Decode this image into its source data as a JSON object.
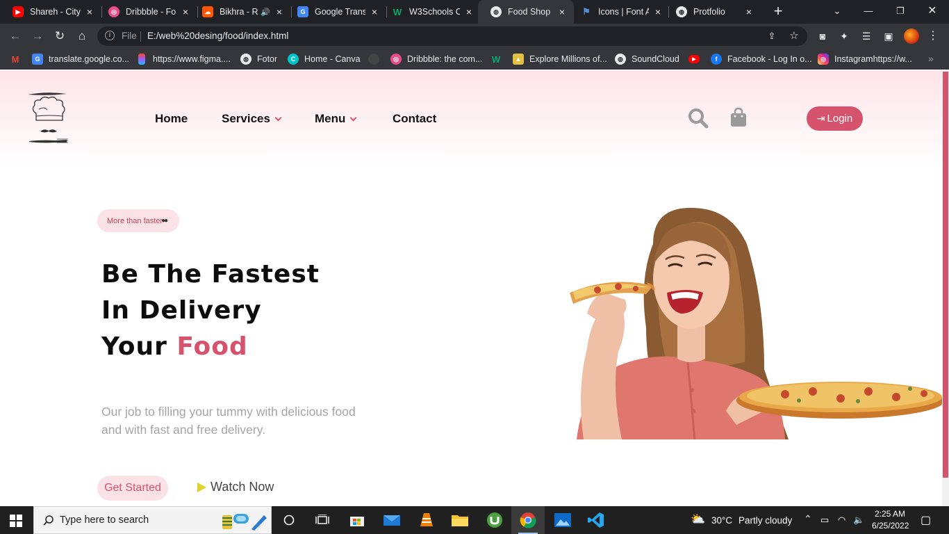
{
  "browser": {
    "tabs": [
      {
        "title": "Shareh - City",
        "icon": "youtube-icon",
        "color": "#ff0000"
      },
      {
        "title": "Dribbble - Fo",
        "icon": "dribbble-icon",
        "color": "#ea4c89"
      },
      {
        "title": "Bikhra - R",
        "icon": "soundcloud-icon",
        "color": "#ff5500",
        "audio": true
      },
      {
        "title": "Google Transl",
        "icon": "google-translate-icon",
        "color": "#4285f4"
      },
      {
        "title": "W3Schools O",
        "icon": "w3schools-icon",
        "color": "#04aa6d"
      },
      {
        "title": "Food Shop",
        "icon": "globe-icon",
        "color": "#e8eaed",
        "active": true
      },
      {
        "title": "Icons | Font A",
        "icon": "font-awesome-icon",
        "color": "#538dd7"
      },
      {
        "title": "Protfolio",
        "icon": "globe-icon",
        "color": "#e8eaed"
      }
    ],
    "address": {
      "scheme_label": "File",
      "url": "E:/web%20desing/food/index.html"
    },
    "bookmarks": [
      {
        "label": "",
        "icon": "gmail-icon",
        "color": "#ea4335"
      },
      {
        "label": "translate.google.co...",
        "icon": "google-translate-icon",
        "color": "#4285f4"
      },
      {
        "label": "https://www.figma....",
        "icon": "figma-icon",
        "color": "#f24e1e"
      },
      {
        "label": "Fotor",
        "icon": "globe-icon",
        "color": "#e8eaed"
      },
      {
        "label": "Home - Canva",
        "icon": "canva-icon",
        "color": "#00c4cc"
      },
      {
        "label": "",
        "icon": "github-icon",
        "color": "#555555"
      },
      {
        "label": "Dribbble: the com...",
        "icon": "dribbble-icon",
        "color": "#ea4c89"
      },
      {
        "label": "",
        "icon": "w3schools-icon",
        "color": "#04aa6d"
      },
      {
        "label": "Explore Millions of...",
        "icon": "image-icon",
        "color": "#e2c044"
      },
      {
        "label": "SoundCloud",
        "icon": "globe-icon",
        "color": "#e8eaed"
      },
      {
        "label": "",
        "icon": "youtube-icon",
        "color": "#ff0000"
      },
      {
        "label": "Facebook - Log In o...",
        "icon": "facebook-icon",
        "color": "#1877f2"
      },
      {
        "label": "Instagramhttps://w...",
        "icon": "instagram-icon",
        "color": "#d6249f"
      }
    ]
  },
  "site": {
    "nav": [
      {
        "label": "Home",
        "dropdown": false
      },
      {
        "label": "Services",
        "dropdown": true
      },
      {
        "label": "Menu",
        "dropdown": true
      },
      {
        "label": "Contact",
        "dropdown": false
      }
    ],
    "login_label": "Login",
    "hero": {
      "badge": "More than faster",
      "title_line1": "Be The Fastest",
      "title_line2": "In Delivery",
      "title_line3_prefix": "Your ",
      "title_line3_accent": "Food",
      "subtitle_line1": "Our job to filling your tummy with delicious food",
      "subtitle_line2": "and with fast and free delivery.",
      "cta_primary": "Get Started",
      "cta_secondary": "Watch Now"
    },
    "accent_color": "#d6536d"
  },
  "taskbar": {
    "search_placeholder": "Type here to search",
    "weather_temp": "30°C",
    "weather_desc": "Partly cloudy",
    "time": "2:25 AM",
    "date": "6/25/2022"
  }
}
